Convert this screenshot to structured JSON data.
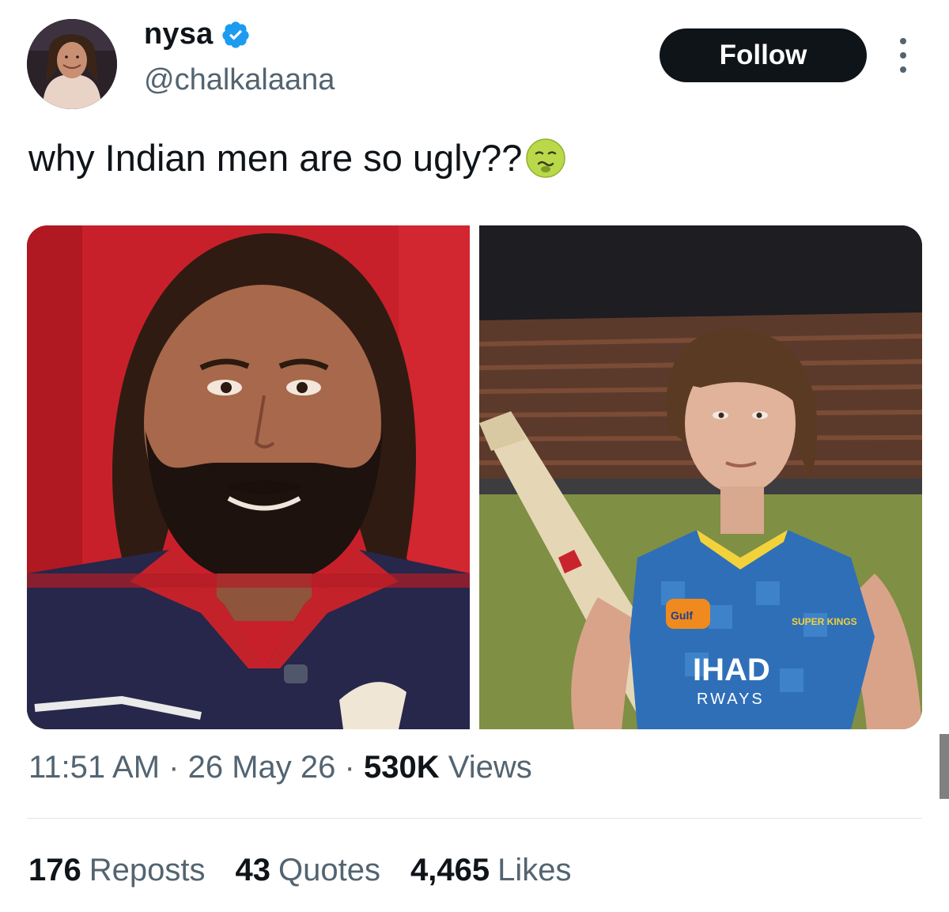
{
  "author": {
    "display_name": "nysa",
    "handle": "@chalkalaana",
    "verified_icon": "verified-badge-icon",
    "avatar": "profile-photo"
  },
  "header": {
    "follow_label": "Follow",
    "more_icon": "more-options-icon"
  },
  "tweet": {
    "text": "why Indian men are so ugly??",
    "emoji": "nauseated-face-emoji"
  },
  "media": {
    "left_photo": "smiling-bearded-man-red-jersey",
    "right_photo": "young-cricketer-with-bat-blue-jersey",
    "left_jersey_text": "",
    "right_jersey_text": {
      "sponsor_top": "Gulf",
      "team": "SUPER KINGS",
      "airline_line1": "IHAD",
      "airline_line2": "RWAYS"
    }
  },
  "meta": {
    "time": "11:51 AM",
    "separator": "·",
    "date": "26 May 26",
    "views_count": "530K",
    "views_label": "Views"
  },
  "stats": {
    "reposts_count": "176",
    "reposts_label": "Reposts",
    "quotes_count": "43",
    "quotes_label": "Quotes",
    "likes_count": "4,465",
    "likes_label": "Likes"
  },
  "colors": {
    "text_primary": "#0f1419",
    "text_secondary": "#536471",
    "verified_blue": "#1d9bf0",
    "follow_bg": "#0f1419"
  }
}
